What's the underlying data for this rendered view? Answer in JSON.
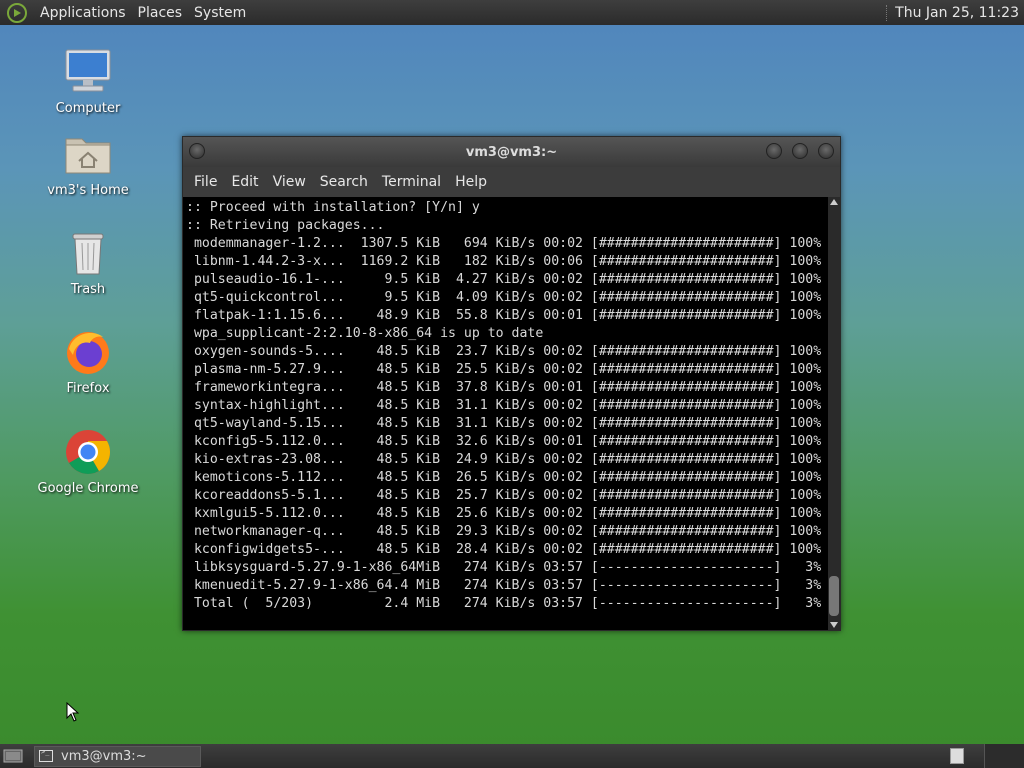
{
  "top_panel": {
    "menus": [
      "Applications",
      "Places",
      "System"
    ],
    "clock": "Thu Jan 25, 11:23"
  },
  "desktop_icons": [
    {
      "label": "Computer",
      "icon": "computer-icon"
    },
    {
      "label": "vm3's Home",
      "icon": "home-folder-icon"
    },
    {
      "label": "Trash",
      "icon": "trash-icon"
    },
    {
      "label": "Firefox",
      "icon": "firefox-icon"
    },
    {
      "label": "Google Chrome",
      "icon": "chrome-icon"
    }
  ],
  "window": {
    "title": "vm3@vm3:~",
    "menus": [
      "File",
      "Edit",
      "View",
      "Search",
      "Terminal",
      "Help"
    ],
    "lines": [
      ":: Proceed with installation? [Y/n] y",
      ":: Retrieving packages...",
      " modemmanager-1.2...  1307.5 KiB   694 KiB/s 00:02 [######################] 100%",
      " libnm-1.44.2-3-x...  1169.2 KiB   182 KiB/s 00:06 [######################] 100%",
      " pulseaudio-16.1-...     9.5 KiB  4.27 KiB/s 00:02 [######################] 100%",
      " qt5-quickcontrol...     9.5 KiB  4.09 KiB/s 00:02 [######################] 100%",
      " flatpak-1:1.15.6...    48.9 KiB  55.8 KiB/s 00:01 [######################] 100%",
      " wpa_supplicant-2:2.10-8-x86_64 is up to date",
      " oxygen-sounds-5....    48.5 KiB  23.7 KiB/s 00:02 [######################] 100%",
      " plasma-nm-5.27.9...    48.5 KiB  25.5 KiB/s 00:02 [######################] 100%",
      " frameworkintegra...    48.5 KiB  37.8 KiB/s 00:01 [######################] 100%",
      " syntax-highlight...    48.5 KiB  31.1 KiB/s 00:02 [######################] 100%",
      " qt5-wayland-5.15...    48.5 KiB  31.1 KiB/s 00:02 [######################] 100%",
      " kconfig5-5.112.0...    48.5 KiB  32.6 KiB/s 00:01 [######################] 100%",
      " kio-extras-23.08...    48.5 KiB  24.9 KiB/s 00:02 [######################] 100%",
      " kemoticons-5.112...    48.5 KiB  26.5 KiB/s 00:02 [######################] 100%",
      " kcoreaddons5-5.1...    48.5 KiB  25.7 KiB/s 00:02 [######################] 100%",
      " kxmlgui5-5.112.0...    48.5 KiB  25.6 KiB/s 00:02 [######################] 100%",
      " networkmanager-q...    48.5 KiB  29.3 KiB/s 00:02 [######################] 100%",
      " kconfigwidgets5-...    48.5 KiB  28.4 KiB/s 00:02 [######################] 100%",
      " libksysguard-5.27.9-1-x86_64MiB   274 KiB/s 03:57 [----------------------]   3%",
      " kmenuedit-5.27.9-1-x86_64.4 MiB   274 KiB/s 03:57 [----------------------]   3%",
      " Total (  5/203)         2.4 MiB   274 KiB/s 03:57 [----------------------]   3%"
    ]
  },
  "taskbar": {
    "task_label": "vm3@vm3:~"
  }
}
